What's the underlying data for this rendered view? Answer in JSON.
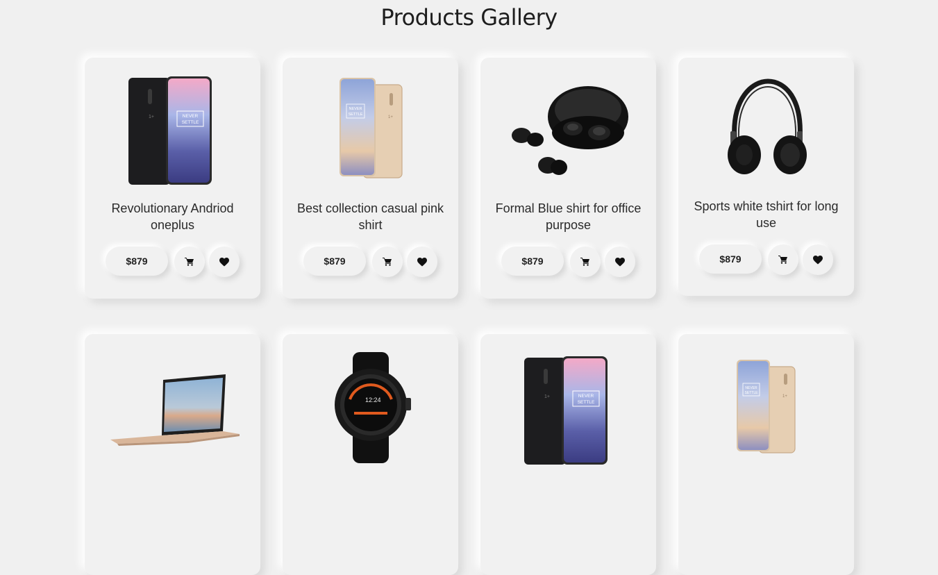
{
  "page": {
    "title": "Products Gallery"
  },
  "products": [
    {
      "name": "Revolutionary Andriod oneplus",
      "price": "$879",
      "image": "oneplus-black-phone"
    },
    {
      "name": "Best collection casual pink shirt",
      "price": "$879",
      "image": "oneplus-gold-phone"
    },
    {
      "name": "Formal  Blue shirt for office purpose",
      "price": "$879",
      "image": "black-earbuds"
    },
    {
      "name": "Sports white tshirt for long use",
      "price": "$879",
      "image": "black-headphones"
    },
    {
      "name": "",
      "price": "",
      "image": "gold-laptop"
    },
    {
      "name": "",
      "price": "",
      "image": "black-smartwatch"
    },
    {
      "name": "",
      "price": "",
      "image": "oneplus-black-phone"
    },
    {
      "name": "",
      "price": "",
      "image": "oneplus-gold-phone"
    }
  ],
  "icons": {
    "cart": "cart-icon",
    "wishlist": "heart-icon"
  },
  "phone_screen_text": [
    "NEVER",
    "SETTLE"
  ]
}
